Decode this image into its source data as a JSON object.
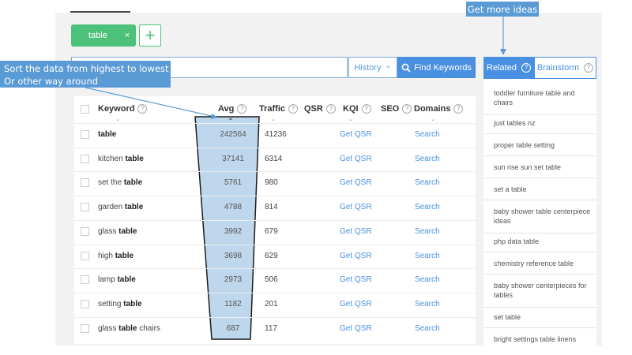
{
  "keyword_tag": {
    "label": "table",
    "remove": "×"
  },
  "add_button": "+",
  "search": {
    "value": "",
    "history_label": "History",
    "history_caret": "⌄",
    "find_label": "Find Keywords"
  },
  "annotations": {
    "sort_line1": "Sort the data from highest to lowest",
    "sort_line2": "Or other way around",
    "more_ideas": "Get more ideas"
  },
  "table": {
    "columns": {
      "keyword": "Keyword",
      "avg": "Avg",
      "traffic": "Traffic",
      "qsr": "QSR",
      "kqi": "KQI",
      "seo": "SEO",
      "domains": "Domains"
    },
    "rows": [
      {
        "pre": "",
        "bold": "table",
        "post": "",
        "avg": "242564",
        "traffic": "41236",
        "qsr": "Get QSR",
        "domains": "Search"
      },
      {
        "pre": "kitchen ",
        "bold": "table",
        "post": "",
        "avg": "37141",
        "traffic": "6314",
        "qsr": "Get QSR",
        "domains": "Search"
      },
      {
        "pre": "set the ",
        "bold": "table",
        "post": "",
        "avg": "5761",
        "traffic": "980",
        "qsr": "Get QSR",
        "domains": "Search"
      },
      {
        "pre": "garden ",
        "bold": "table",
        "post": "",
        "avg": "4788",
        "traffic": "814",
        "qsr": "Get QSR",
        "domains": "Search"
      },
      {
        "pre": "glass ",
        "bold": "table",
        "post": "",
        "avg": "3992",
        "traffic": "679",
        "qsr": "Get QSR",
        "domains": "Search"
      },
      {
        "pre": "high ",
        "bold": "table",
        "post": "",
        "avg": "3698",
        "traffic": "629",
        "qsr": "Get QSR",
        "domains": "Search"
      },
      {
        "pre": "lamp ",
        "bold": "table",
        "post": "",
        "avg": "2973",
        "traffic": "506",
        "qsr": "Get QSR",
        "domains": "Search"
      },
      {
        "pre": "setting ",
        "bold": "table",
        "post": "",
        "avg": "1182",
        "traffic": "201",
        "qsr": "Get QSR",
        "domains": "Search"
      },
      {
        "pre": "glass ",
        "bold": "table",
        "post": " chairs",
        "avg": "687",
        "traffic": "117",
        "qsr": "Get QSR",
        "domains": "Search"
      }
    ]
  },
  "sidebar": {
    "tab_related": "Related",
    "tab_brainstorm": "Brainstorm",
    "items": [
      "toddler furniture table and chairs",
      "just tables nz",
      "proper table setting",
      "sun rise sun set table",
      "set a table",
      "baby shower table centerpiece ideas",
      "php data table",
      "chemistry reference table",
      "baby shower centerpieces for tables",
      "set table",
      "bright settings table linens"
    ]
  },
  "colors": {
    "accent": "#4a90e2",
    "tag_green": "#4cc17a",
    "annotation_blue": "#5b9bd5",
    "highlight": "#b7d3ea"
  }
}
